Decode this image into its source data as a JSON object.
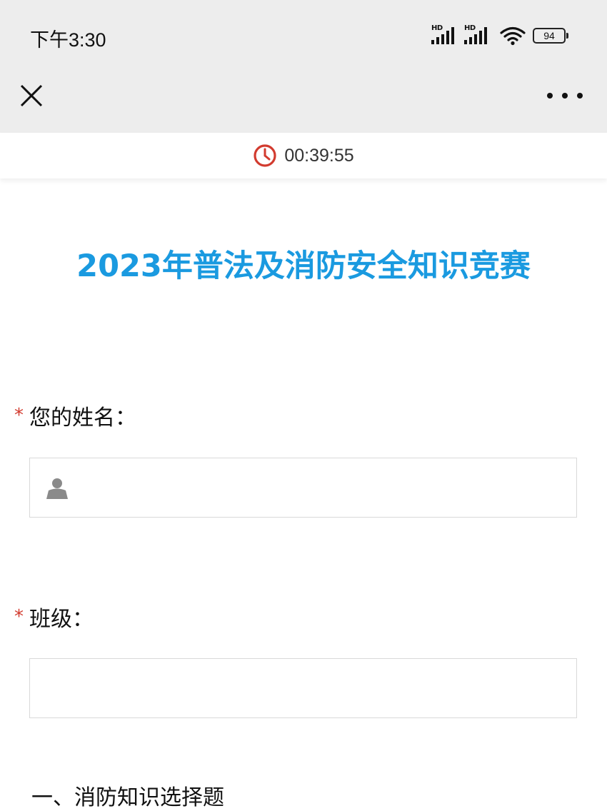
{
  "status_bar": {
    "time": "下午3:30",
    "signal_labels": [
      "HD",
      "HD"
    ],
    "battery": "94"
  },
  "nav": {
    "close_icon": "close-icon",
    "more_icon": "more-dots-icon"
  },
  "timer": {
    "icon": "clock-icon",
    "value": "00:39:55",
    "icon_color": "#d23b2f"
  },
  "form": {
    "title": "2023年普法及消防安全知识竞赛",
    "title_color": "#1a9ae0",
    "questions": [
      {
        "required": "*",
        "label": "您的姓名：",
        "value": "",
        "icon": "user-icon"
      },
      {
        "required": "*",
        "label": "班级：",
        "value": ""
      }
    ],
    "section_title": "一、消防知识选择题"
  }
}
